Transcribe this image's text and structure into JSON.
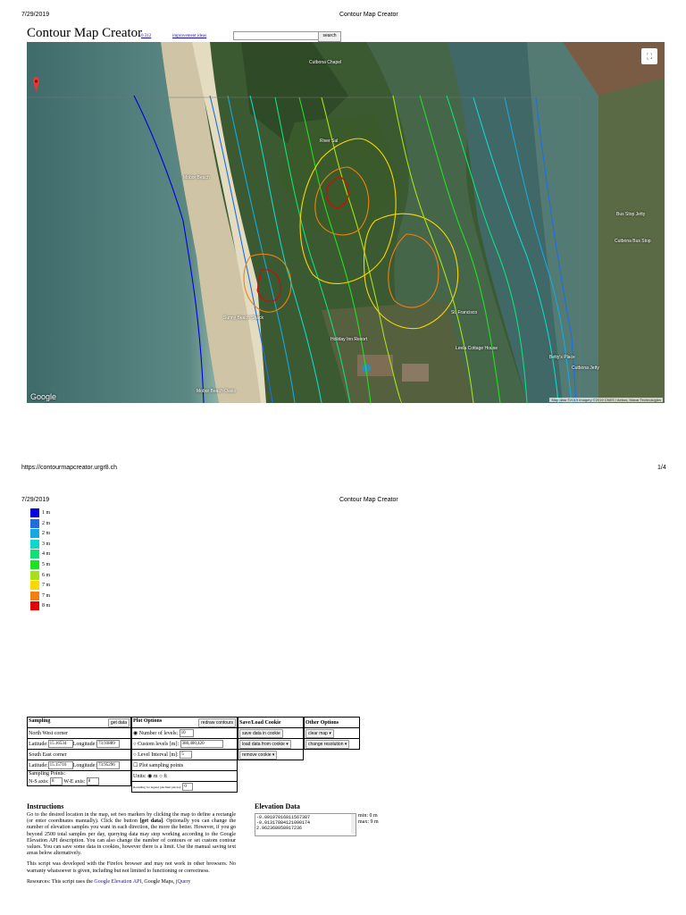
{
  "print": {
    "date": "7/29/2019",
    "doc_title": "Contour Map Creator",
    "footer_url": "https://contourmapcreator.urgr8.ch",
    "page_1": "1/4"
  },
  "header": {
    "title": "Contour Map Creator",
    "version_link": "0.312",
    "ideas_link": "improvement ideas",
    "search_button": "search",
    "search_value": ""
  },
  "map": {
    "fullscreen_icon": "fullscreen-icon",
    "marker_icon": "map-marker-icon",
    "labels": {
      "chapel": "Cutbona Chapel",
      "beach_a": "Mobor Beach",
      "shack": "Sunny Beach Shack",
      "beach_b": "Mobor Beach Oasis",
      "resort": "Holiday Inn Resort",
      "house": "Leela Cottage House",
      "place": "Betty's Place",
      "cove": "Cutbona Jetty",
      "river": "River Sal",
      "bus": "Cutbona Bus Stop",
      "bus2": "Bus Stop Jetty",
      "francisco": "St. Francisco"
    },
    "google": "Google",
    "attribution": "Map data ©2019 Imagery ©2019 CNES / Airbus, Maxar Technologies"
  },
  "legend": [
    {
      "label": "1 m",
      "color": "#0000e0"
    },
    {
      "label": "2 m",
      "color": "#1e6ee0"
    },
    {
      "label": "2 m",
      "color": "#18a8e0"
    },
    {
      "label": "3 m",
      "color": "#10d8c8"
    },
    {
      "label": "4 m",
      "color": "#10e078"
    },
    {
      "label": "5 m",
      "color": "#20e020"
    },
    {
      "label": "6 m",
      "color": "#a8e018"
    },
    {
      "label": "7 m",
      "color": "#f8d800"
    },
    {
      "label": "7 m",
      "color": "#f08010"
    },
    {
      "label": "8 m",
      "color": "#e80000"
    }
  ],
  "sampling": {
    "title": "Sampling",
    "get_data": "get data",
    "nw_corner": "North West corner",
    "se_corner": "South East corner",
    "latitude": "Latitude:",
    "longitude": "Longitude:",
    "nw_lat": "15.16534",
    "nw_lng": "73.93889",
    "se_lat": "15.15716",
    "se_lng": "73.95296",
    "points": "Sampling Points:",
    "ns_axis": "N-S axis:",
    "we_axis": "W-E axis:",
    "ns_val": "8",
    "we_val": "8"
  },
  "plot": {
    "title": "Plot Options",
    "redraw": "redraw contours",
    "num_levels": "Number of levels:",
    "num_levels_val": "10",
    "custom_levels": "Custom levels [m]:",
    "custom_levels_val": "380,400,420",
    "level_interval": "Level Interval [m]:",
    "level_interval_val": "5",
    "plot_points": "Plot sampling points",
    "units": "Units:",
    "unit_m": "m",
    "unit_ft": "ft",
    "rounding": "Rounding for legend (decimal places):",
    "rounding_val": "0"
  },
  "saveload": {
    "title": "Save/Load Cookie",
    "save": "save data in cookie",
    "load": "load data from cookie",
    "remove": "remove cookie"
  },
  "other": {
    "title": "Other Options",
    "clear": "clear map",
    "resolution": "change resolution"
  },
  "instructions": {
    "title": "Instructions",
    "p1a": "Go to the desired location in the map, set two markers by clicking the map to define a rectangle (or enter coordinates manually). Click the button ",
    "p1b": "[get data]",
    "p1c": ". Optionally you can change the number of elevation samples you want in each direction, the more the better. However, if you go beyond 2500 total samples per day, querying data may stop working according to the Google Elevation API description. You can also change the number of contours or set custom contour values. You can save some data in cookies, however there is a limit. Use the manual saving text areas below alternatively.",
    "p2": "This script was developed with the Firefox browser and may not work in other browsers. No warranty whatsoever is given, including but not limited to functioning or correctness.",
    "p3a": "Resources: This script uses the ",
    "p3b": "Google Elevation API",
    "p3c": ", Google Maps, ",
    "p3d": "jQuery"
  },
  "elevation": {
    "title": "Elevation Data",
    "lines": [
      "-0.09107016811567387",
      "-0.01317884121090174",
      "2.962368058917236"
    ],
    "min": "min: 0 m",
    "max": "max: 9 m"
  }
}
